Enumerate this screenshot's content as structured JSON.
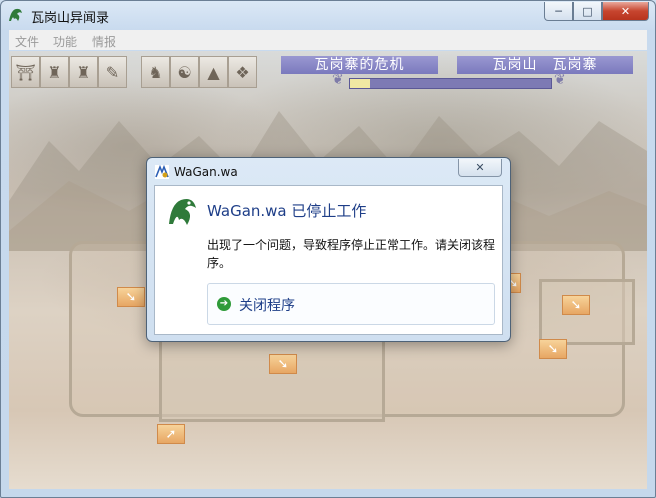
{
  "window": {
    "title": "瓦岗山异闻录",
    "buttons": {
      "minimize": "─",
      "maximize": "□",
      "close": "✕"
    }
  },
  "menu": [
    "文件",
    "功能",
    "情报"
  ],
  "toolbar": {
    "icons": [
      "city-gate-icon",
      "palace-icon",
      "palace-icon",
      "scroll-icon",
      "soldier-icon",
      "general-icon",
      "mountain-icon",
      "book-icon"
    ]
  },
  "banners": {
    "scenario": "瓦岗寨的危机",
    "location": "瓦岗山　瓦岗寨"
  },
  "progress": {
    "fraction": 0.1
  },
  "dialog": {
    "title": "WaGan.wa",
    "heading": "WaGan.wa 已停止工作",
    "message": "出现了一个问题，导致程序停止正常工作。请关闭该程序。",
    "action_label": "关闭程序",
    "close_glyph": "✕"
  },
  "colors": {
    "banner": "#8b89c8",
    "action_text": "#1e3e88",
    "close_button": "#c7452f"
  }
}
